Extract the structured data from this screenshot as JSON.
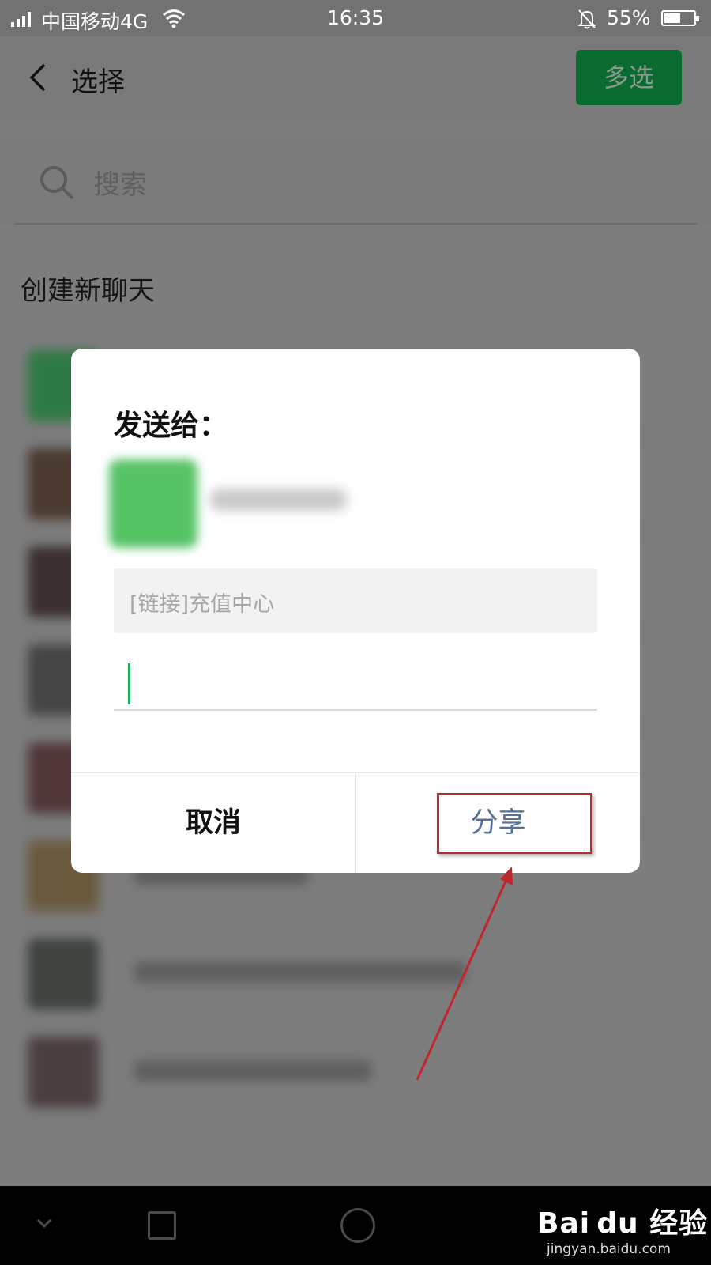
{
  "status_bar": {
    "carrier": "中国移动4G",
    "time": "16:35",
    "battery": "55%",
    "battery_level": 0.55
  },
  "header": {
    "title": "选择",
    "multiselect_label": "多选"
  },
  "search": {
    "placeholder": "搜索"
  },
  "new_chat_label": "创建新聊天",
  "dialog": {
    "title": "发送给：",
    "link_preview": "[链接]充值中心",
    "message_value": "",
    "cancel_label": "取消",
    "share_label": "分享"
  },
  "watermark": {
    "logo": "Bai du 经验",
    "url": "jingyan.baidu.com"
  },
  "colors": {
    "accent_green": "#1aad5e",
    "share_blue": "#56709a",
    "annotation_red": "#c0262b"
  },
  "icons": [
    "signal-icon",
    "wifi-icon",
    "bell-off-icon",
    "battery-icon",
    "back-icon",
    "search-icon",
    "nav-back-icon",
    "nav-home-icon",
    "nav-recent-icon"
  ]
}
